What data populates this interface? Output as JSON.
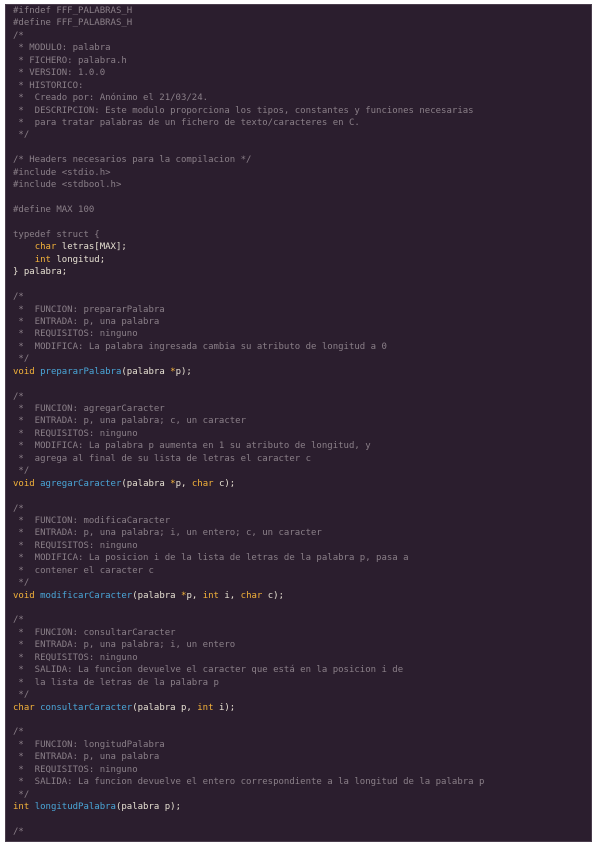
{
  "editor": {
    "language": "C",
    "lines": [
      [
        [
          "p",
          "#ifndef FFF_PALABRAS_H"
        ]
      ],
      [
        [
          "p",
          "#define FFF_PALABRAS_H"
        ]
      ],
      [
        [
          "c",
          "/*"
        ]
      ],
      [
        [
          "c",
          " * MODULO: palabra"
        ]
      ],
      [
        [
          "c",
          " * FICHERO: palabra.h"
        ]
      ],
      [
        [
          "c",
          " * VERSION: 1.0.0"
        ]
      ],
      [
        [
          "c",
          " * HISTORICO:"
        ]
      ],
      [
        [
          "c",
          " *  Creado por: Anónimo el 21/03/24."
        ]
      ],
      [
        [
          "c",
          " *  DESCRIPCION: Este modulo proporciona los tipos, constantes y funciones necesarias"
        ]
      ],
      [
        [
          "c",
          " *  para tratar palabras de un fichero de texto/caracteres en C."
        ]
      ],
      [
        [
          "c",
          " */"
        ]
      ],
      [
        [
          "x",
          ""
        ]
      ],
      [
        [
          "c",
          "/* Headers necesarios para la compilacion */"
        ]
      ],
      [
        [
          "p",
          "#include <stdio.h>"
        ]
      ],
      [
        [
          "p",
          "#include <stdbool.h>"
        ]
      ],
      [
        [
          "x",
          ""
        ]
      ],
      [
        [
          "p",
          "#define MAX 100"
        ]
      ],
      [
        [
          "x",
          ""
        ]
      ],
      [
        [
          "p",
          "typedef struct {"
        ]
      ],
      [
        [
          "x",
          "    "
        ],
        [
          "k",
          "char"
        ],
        [
          "x",
          " letras[MAX];"
        ]
      ],
      [
        [
          "x",
          "    "
        ],
        [
          "k",
          "int"
        ],
        [
          "x",
          " longitud;"
        ]
      ],
      [
        [
          "x",
          "} palabra;"
        ]
      ],
      [
        [
          "x",
          ""
        ]
      ],
      [
        [
          "c",
          "/*"
        ]
      ],
      [
        [
          "c",
          " *  FUNCION: prepararPalabra"
        ]
      ],
      [
        [
          "c",
          " *  ENTRADA: p, una palabra"
        ]
      ],
      [
        [
          "c",
          " *  REQUISITOS: ninguno"
        ]
      ],
      [
        [
          "c",
          " *  MODIFICA: La palabra ingresada cambia su atributo de longitud a 0"
        ]
      ],
      [
        [
          "c",
          " */"
        ]
      ],
      [
        [
          "k",
          "void"
        ],
        [
          "x",
          " "
        ],
        [
          "f",
          "prepararPalabra"
        ],
        [
          "x",
          "(palabra "
        ],
        [
          "o",
          "*"
        ],
        [
          "x",
          "p);"
        ]
      ],
      [
        [
          "x",
          ""
        ]
      ],
      [
        [
          "c",
          "/*"
        ]
      ],
      [
        [
          "c",
          " *  FUNCION: agregarCaracter"
        ]
      ],
      [
        [
          "c",
          " *  ENTRADA: p, una palabra; c, un caracter"
        ]
      ],
      [
        [
          "c",
          " *  REQUISITOS: ninguno"
        ]
      ],
      [
        [
          "c",
          " *  MODIFICA: La palabra p aumenta en 1 su atributo de longitud, y"
        ]
      ],
      [
        [
          "c",
          " *  agrega al final de su lista de letras el caracter c"
        ]
      ],
      [
        [
          "c",
          " */"
        ]
      ],
      [
        [
          "k",
          "void"
        ],
        [
          "x",
          " "
        ],
        [
          "f",
          "agregarCaracter"
        ],
        [
          "x",
          "(palabra "
        ],
        [
          "o",
          "*"
        ],
        [
          "x",
          "p, "
        ],
        [
          "k",
          "char"
        ],
        [
          "x",
          " c);"
        ]
      ],
      [
        [
          "x",
          ""
        ]
      ],
      [
        [
          "c",
          "/*"
        ]
      ],
      [
        [
          "c",
          " *  FUNCION: modificaCaracter"
        ]
      ],
      [
        [
          "c",
          " *  ENTRADA: p, una palabra; i, un entero; c, un caracter"
        ]
      ],
      [
        [
          "c",
          " *  REQUISITOS: ninguno"
        ]
      ],
      [
        [
          "c",
          " *  MODIFICA: La posicion i de la lista de letras de la palabra p, pasa a"
        ]
      ],
      [
        [
          "c",
          " *  contener el caracter c"
        ]
      ],
      [
        [
          "c",
          " */"
        ]
      ],
      [
        [
          "k",
          "void"
        ],
        [
          "x",
          " "
        ],
        [
          "f",
          "modificarCaracter"
        ],
        [
          "x",
          "(palabra "
        ],
        [
          "o",
          "*"
        ],
        [
          "x",
          "p, "
        ],
        [
          "k",
          "int"
        ],
        [
          "x",
          " i, "
        ],
        [
          "k",
          "char"
        ],
        [
          "x",
          " c);"
        ]
      ],
      [
        [
          "x",
          ""
        ]
      ],
      [
        [
          "c",
          "/*"
        ]
      ],
      [
        [
          "c",
          " *  FUNCION: consultarCaracter"
        ]
      ],
      [
        [
          "c",
          " *  ENTRADA: p, una palabra; i, un entero"
        ]
      ],
      [
        [
          "c",
          " *  REQUISITOS: ninguno"
        ]
      ],
      [
        [
          "c",
          " *  SALIDA: La funcion devuelve el caracter que está en la posicion i de"
        ]
      ],
      [
        [
          "c",
          " *  la lista de letras de la palabra p"
        ]
      ],
      [
        [
          "c",
          " */"
        ]
      ],
      [
        [
          "k",
          "char"
        ],
        [
          "x",
          " "
        ],
        [
          "f",
          "consultarCaracter"
        ],
        [
          "x",
          "(palabra p, "
        ],
        [
          "k",
          "int"
        ],
        [
          "x",
          " i);"
        ]
      ],
      [
        [
          "x",
          ""
        ]
      ],
      [
        [
          "c",
          "/*"
        ]
      ],
      [
        [
          "c",
          " *  FUNCION: longitudPalabra"
        ]
      ],
      [
        [
          "c",
          " *  ENTRADA: p, una palabra"
        ]
      ],
      [
        [
          "c",
          " *  REQUISITOS: ninguno"
        ]
      ],
      [
        [
          "c",
          " *  SALIDA: La funcion devuelve el entero correspondiente a la longitud de la palabra p"
        ]
      ],
      [
        [
          "c",
          " */"
        ]
      ],
      [
        [
          "k",
          "int"
        ],
        [
          "x",
          " "
        ],
        [
          "f",
          "longitudPalabra"
        ],
        [
          "x",
          "(palabra p);"
        ]
      ],
      [
        [
          "x",
          ""
        ]
      ],
      [
        [
          "c",
          "/*"
        ]
      ]
    ]
  },
  "colors": {
    "background": "#2b1e2e",
    "comment": "#8a7f88",
    "keyword": "#f3b23a",
    "function": "#4aa6d8",
    "text": "#e6e0d2"
  }
}
